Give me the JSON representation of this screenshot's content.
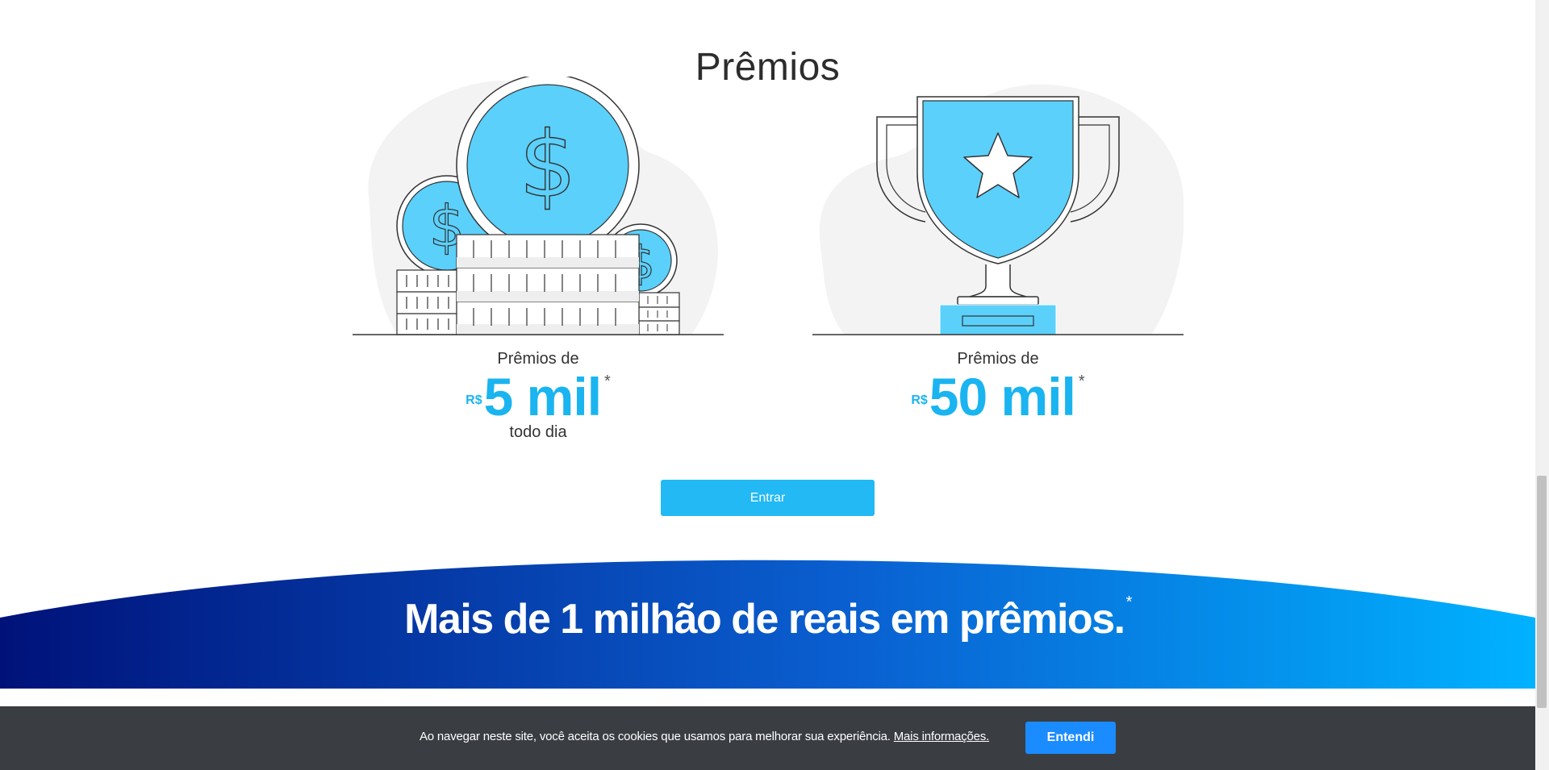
{
  "section": {
    "title": "Prêmios"
  },
  "prizes": [
    {
      "label": "Prêmios de",
      "currency": "R$",
      "amount": "5 mil",
      "asterisk": "*",
      "subtext": "todo dia"
    },
    {
      "label": "Prêmios de",
      "currency": "R$",
      "amount": "50 mil",
      "asterisk": "*",
      "subtext": ""
    }
  ],
  "cta": {
    "label": "Entrar"
  },
  "banner": {
    "headline": "Mais de 1 milhão de reais em prêmios.",
    "asterisk": "*"
  },
  "cookie": {
    "message": "Ao navegar neste site, você aceita os cookies que usamos para melhorar sua experiência.",
    "link_label": "Mais informações.",
    "button_label": "Entendi"
  },
  "colors": {
    "accent": "#1ab4f0",
    "button": "#22b9f4",
    "banner_start": "#00127a",
    "banner_end": "#00b2ff",
    "cookie_bg": "#3a3d42",
    "cookie_button": "#1a8cff"
  },
  "icons": [
    "coins-illustration",
    "trophy-illustration",
    "star-icon",
    "dollar-sign-icon"
  ]
}
